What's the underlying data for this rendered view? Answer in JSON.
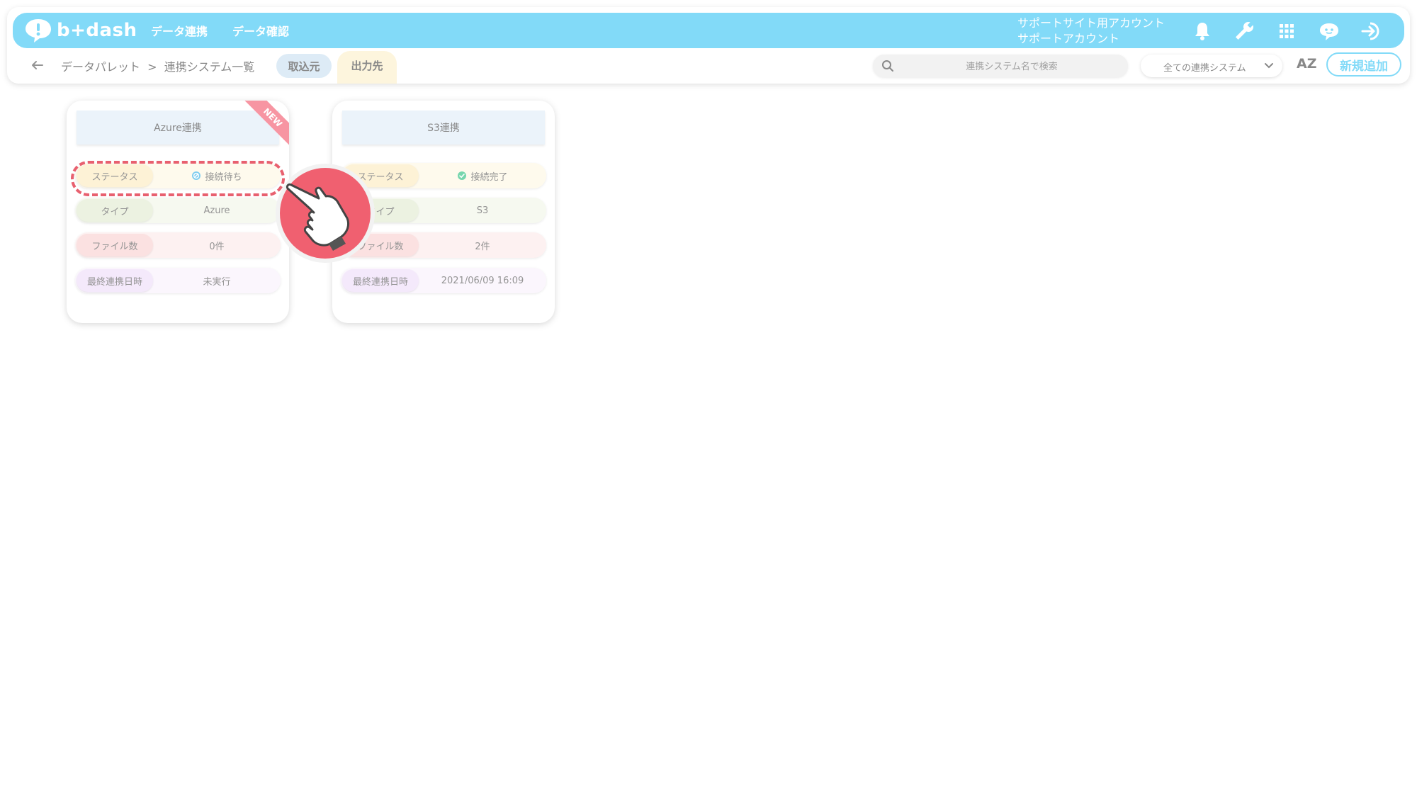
{
  "header": {
    "logo_text": "b+dash",
    "nav": [
      {
        "label": "データ連携"
      },
      {
        "label": "データ確認"
      }
    ],
    "account_line1": "サポートサイト用アカウント",
    "account_line2": "サポートアカウント",
    "icons": [
      "bell-icon",
      "wrench-icon",
      "grid-icon",
      "chat-bot-icon",
      "logout-icon"
    ],
    "accent": "#4dcbf5"
  },
  "subbar": {
    "breadcrumb": "データパレット  >  連携システム一覧",
    "tab_in": "取込元",
    "tab_out": "出力先",
    "search_placeholder": "連携システム名で検索",
    "filter_selected": "全ての連携システム",
    "sort_label": "AZ",
    "add_button": "新規追加"
  },
  "cards": [
    {
      "title": "Azure連携",
      "badge": "NEW",
      "status_label": "ステータス",
      "status_value": "接続待ち",
      "status_icon": "pending-icon",
      "type_label": "タイプ",
      "type_value": "Azure",
      "files_label": "ファイル数",
      "files_value": "0件",
      "date_label": "最終連携日時",
      "date_value": "未実行"
    },
    {
      "title": "S3連携",
      "status_label": "ステータス",
      "status_value": "接続完了",
      "status_icon": "check-icon",
      "type_label": "タイプ",
      "type_value": "S3",
      "files_label": "ファイル数",
      "files_value": "2件",
      "date_label": "最終連携日時",
      "date_value": "2021/06/09 16:09"
    }
  ],
  "colors": {
    "highlight": "#e8606f",
    "ribbon": "#f4687a",
    "status_ok": "#3cc48a",
    "status_wait": "#4ab8e8"
  }
}
